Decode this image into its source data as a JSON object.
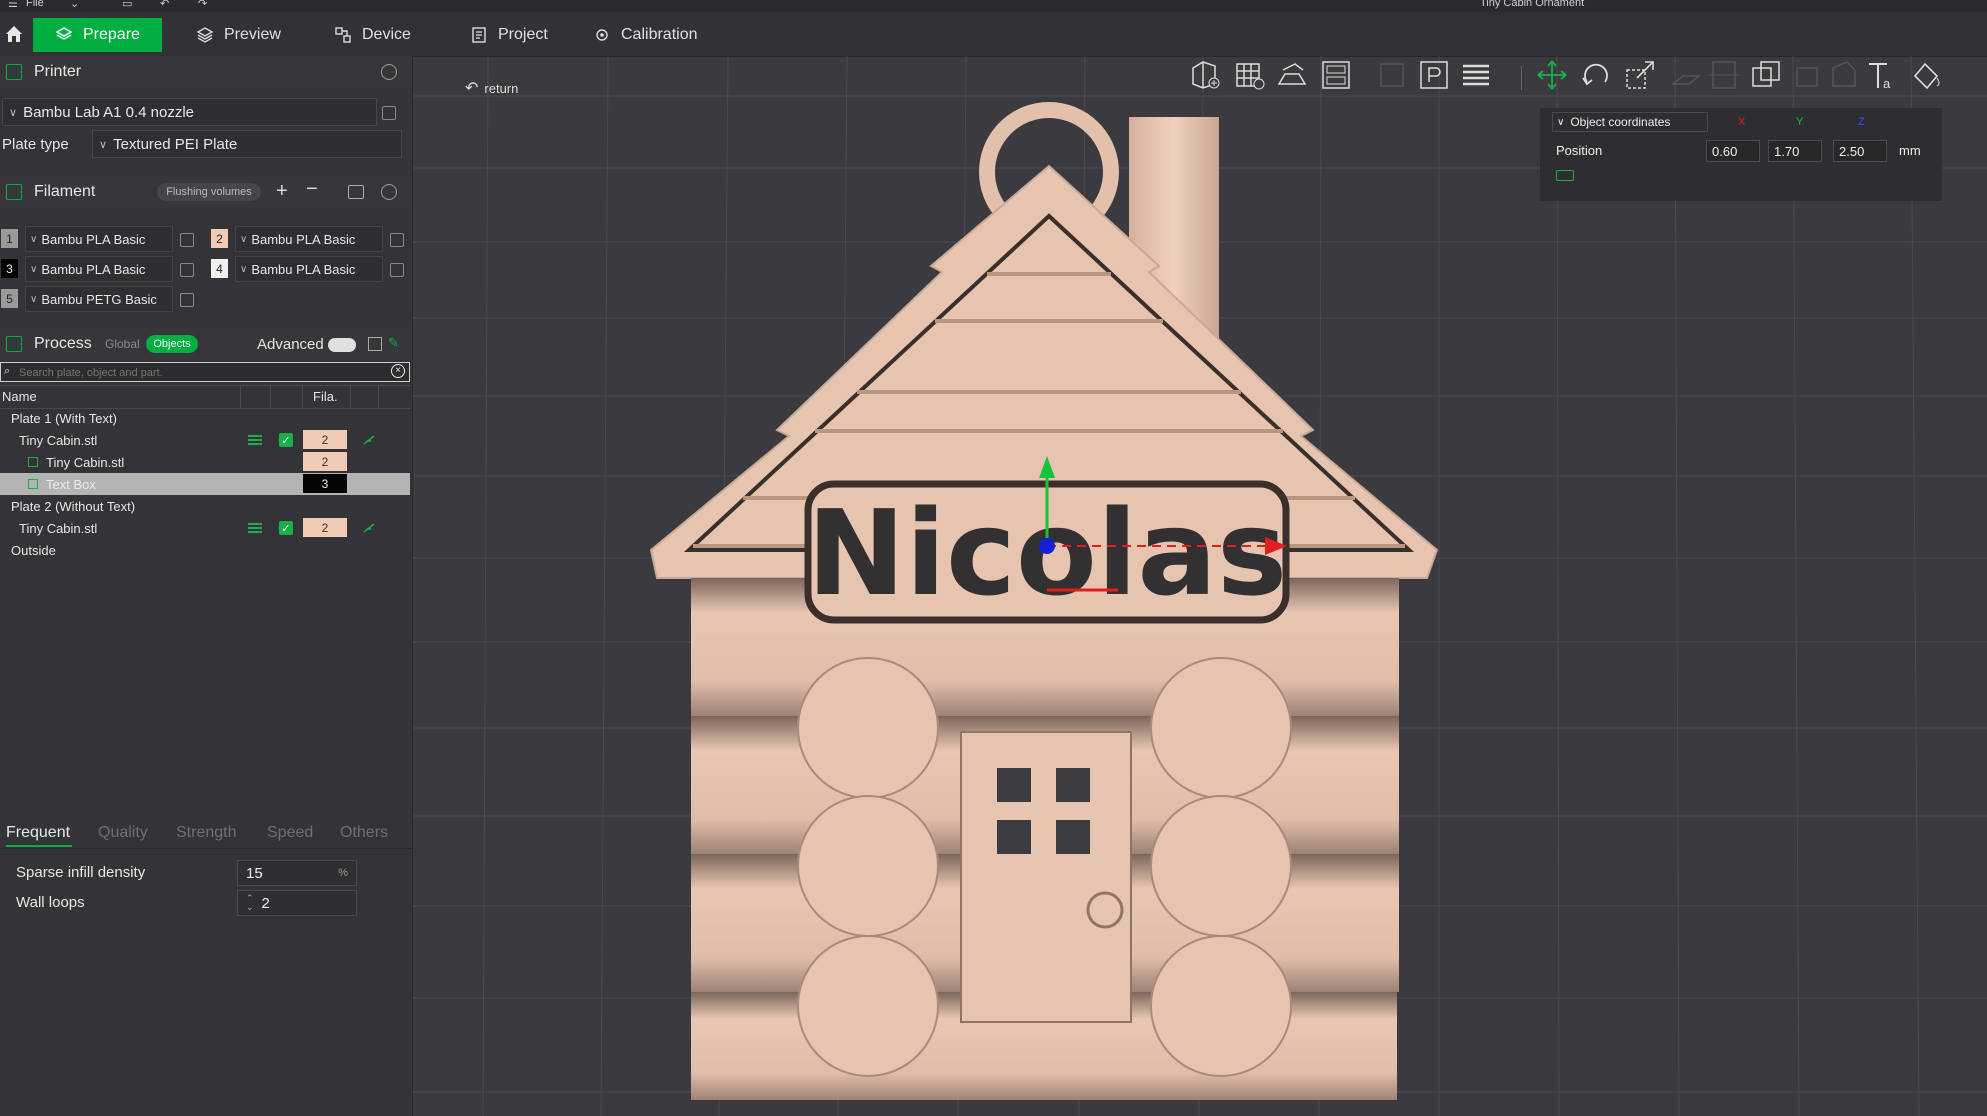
{
  "menubar": {
    "file_label": "File",
    "window_title": "Tiny Cabin Ornament"
  },
  "tabs": [
    {
      "label": "Prepare"
    },
    {
      "label": "Preview"
    },
    {
      "label": "Device"
    },
    {
      "label": "Project"
    },
    {
      "label": "Calibration"
    }
  ],
  "printer": {
    "section_title": "Printer",
    "name": "Bambu Lab A1 0.4 nozzle",
    "plate_type_label": "Plate type",
    "plate_type_value": "Textured PEI Plate"
  },
  "filament": {
    "section_title": "Filament",
    "flushing_label": "Flushing volumes",
    "slots": [
      {
        "num": "1",
        "name": "Bambu PLA Basic",
        "color": "#9a9a9a"
      },
      {
        "num": "2",
        "name": "Bambu PLA Basic",
        "color": "#f2cbb6"
      },
      {
        "num": "3",
        "name": "Bambu PLA Basic",
        "color": "#050505"
      },
      {
        "num": "4",
        "name": "Bambu PLA Basic",
        "color": "#f0f0f0"
      },
      {
        "num": "5",
        "name": "Bambu PETG Basic",
        "color": "#9a9a9a"
      }
    ]
  },
  "process": {
    "section_title": "Process",
    "global_label": "Global",
    "objects_label": "Objects",
    "advanced_label": "Advanced",
    "search_placeholder": "Search plate, object and part.",
    "col_name": "Name",
    "col_fila": "Fila.",
    "tree": [
      {
        "label": "Plate 1 (With Text)"
      },
      {
        "label": "Tiny Cabin.stl",
        "fila": "2"
      },
      {
        "label": "Tiny Cabin.stl",
        "fila": "2"
      },
      {
        "label": "Text Box",
        "fila": "3"
      },
      {
        "label": "Plate 2 (Without Text)"
      },
      {
        "label": "Tiny Cabin.stl",
        "fila": "2"
      },
      {
        "label": "Outside"
      }
    ],
    "param_tabs": [
      "Frequent",
      "Quality",
      "Strength",
      "Speed",
      "Others"
    ],
    "params": [
      {
        "label": "Sparse infill density",
        "value": "15",
        "unit": "%"
      },
      {
        "label": "Wall loops",
        "value": "2"
      }
    ]
  },
  "viewport": {
    "return_label": "return",
    "model_text": "Nicolas",
    "coords": {
      "mode": "Object coordinates",
      "x_label": "X",
      "y_label": "Y",
      "z_label": "Z",
      "position_label": "Position",
      "x": "0.60",
      "y": "1.70",
      "z": "2.50",
      "unit": "mm"
    }
  },
  "colors": {
    "accent": "#00ae42",
    "model": "#e6c4b0",
    "background": "#3a3a3f"
  }
}
